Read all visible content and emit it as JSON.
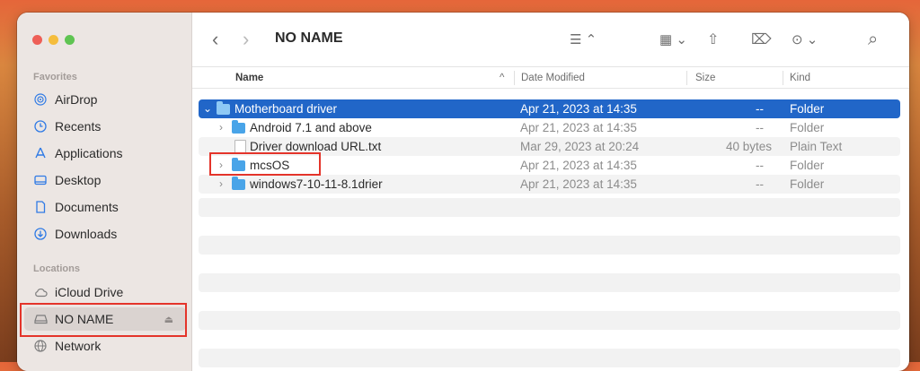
{
  "window": {
    "title": "NO NAME"
  },
  "colors": {
    "accent": "#2166c8",
    "highlight_box": "#e4342a",
    "folder": "#49a4e8"
  },
  "sidebar": {
    "favorites_header": "Favorites",
    "favorites": [
      {
        "label": "AirDrop",
        "icon": "airdrop-icon"
      },
      {
        "label": "Recents",
        "icon": "clock-icon"
      },
      {
        "label": "Applications",
        "icon": "applications-icon"
      },
      {
        "label": "Desktop",
        "icon": "desktop-icon"
      },
      {
        "label": "Documents",
        "icon": "document-icon"
      },
      {
        "label": "Downloads",
        "icon": "download-icon"
      }
    ],
    "locations_header": "Locations",
    "locations": [
      {
        "label": "iCloud Drive",
        "icon": "cloud-icon"
      },
      {
        "label": "NO NAME",
        "icon": "drive-icon",
        "selected": true
      },
      {
        "label": "Network",
        "icon": "network-icon"
      }
    ]
  },
  "toolbar": {
    "back": "‹",
    "forward": "›",
    "list_view": "☰ ⌃",
    "group": "▦ ⌄",
    "share": "⇧",
    "tag": "⌦",
    "more": "⊙ ⌄",
    "search": "⌕"
  },
  "columns": {
    "name": "Name",
    "date": "Date Modified",
    "size": "Size",
    "kind": "Kind",
    "sort_indicator": "^"
  },
  "files": [
    {
      "name": "Motherboard driver",
      "date": "Apr 21, 2023 at 14:35",
      "size": "--",
      "kind": "Folder",
      "type": "folder",
      "expanded": true
    },
    {
      "name": "Android 7.1 and above",
      "date": "Apr 21, 2023 at 14:35",
      "size": "--",
      "kind": "Folder",
      "type": "folder"
    },
    {
      "name": "Driver download URL.txt",
      "date": "Mar 29, 2023 at 20:24",
      "size": "40 bytes",
      "kind": "Plain Text",
      "type": "file"
    },
    {
      "name": "mcsOS",
      "date": "Apr 21, 2023 at 14:35",
      "size": "--",
      "kind": "Folder",
      "type": "folder"
    },
    {
      "name": "windows7-10-11-8.1drier",
      "date": "Apr 21, 2023 at 14:35",
      "size": "--",
      "kind": "Folder",
      "type": "folder"
    }
  ]
}
